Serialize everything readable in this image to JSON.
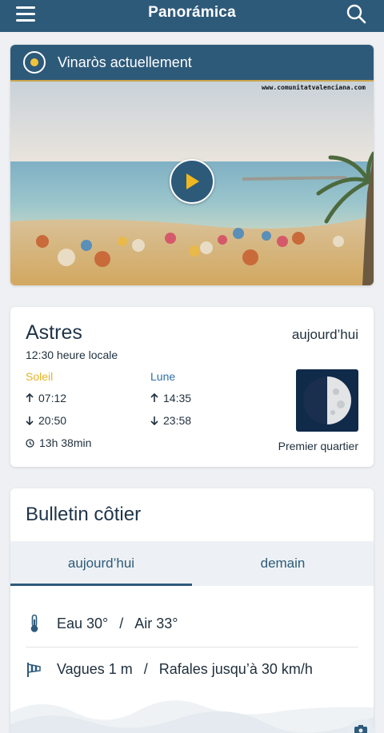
{
  "topbar": {
    "title": "Panorámica"
  },
  "webcam": {
    "title": "Vinaròs actuellement",
    "watermark": "www.comunitatvalenciana.com"
  },
  "astres": {
    "title": "Astres",
    "day": "aujourd’hui",
    "local_time": "12:30 heure locale",
    "sun": {
      "label": "Soleil",
      "rise": "07:12",
      "set": "20:50",
      "duration": "13h 38min"
    },
    "moon": {
      "label": "Lune",
      "rise": "14:35",
      "set": "23:58",
      "phase": "Premier quartier"
    }
  },
  "bulletin": {
    "title": "Bulletin côtier",
    "tabs": [
      {
        "label": "aujourd’hui"
      },
      {
        "label": "demain"
      }
    ],
    "water": "Eau 30°",
    "slash1": "/",
    "air": "Air 33°",
    "waves": "Vagues 1 m",
    "slash2": "/",
    "gusts": "Rafales jusqu’à 30 km/h"
  },
  "colors": {
    "header": "#2e5a7a",
    "sun": "#e6b323",
    "moon": "#2e6fa6"
  }
}
